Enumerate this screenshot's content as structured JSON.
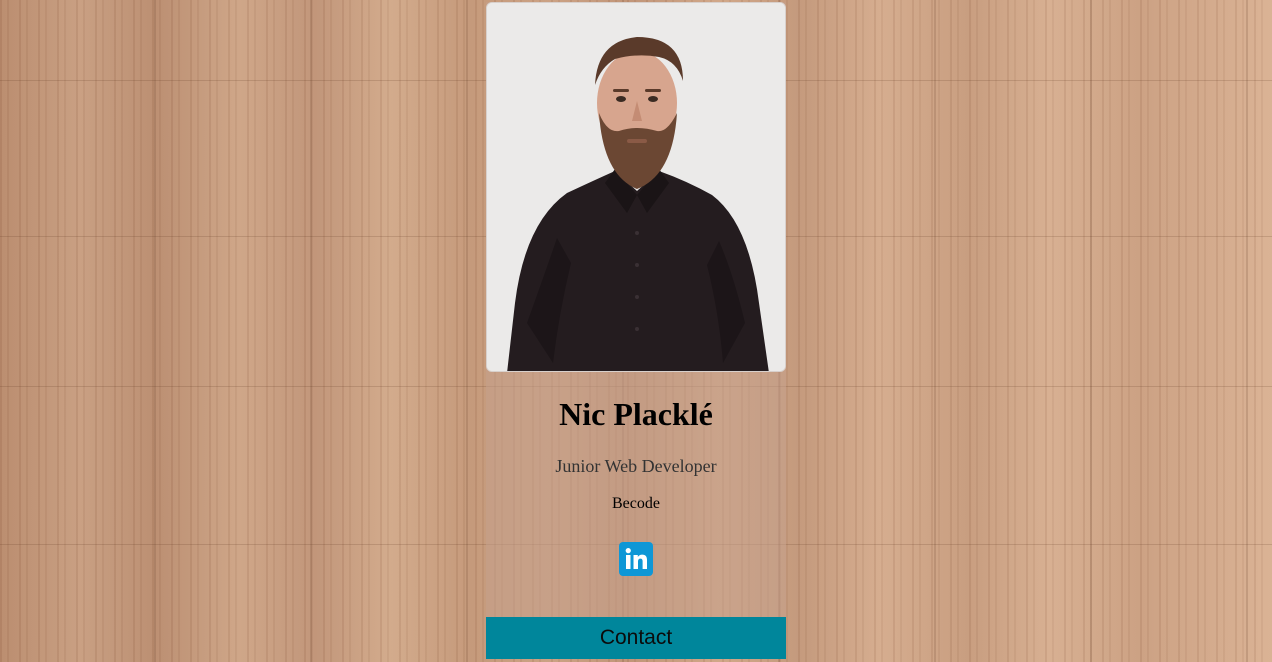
{
  "profile": {
    "name": "Nic Placklé",
    "role": "Junior Web Developer",
    "organization": "Becode",
    "photo_alt": "Portrait photo"
  },
  "social": {
    "linkedin_icon": "linkedin-icon"
  },
  "actions": {
    "contact_label": "Contact"
  },
  "colors": {
    "contact_button": "#00869b",
    "linkedin": "#0e97d6"
  }
}
